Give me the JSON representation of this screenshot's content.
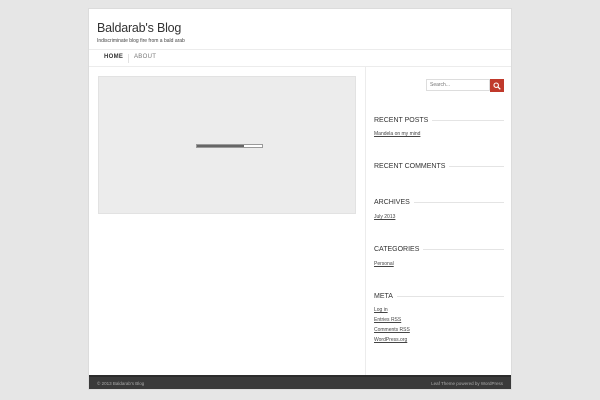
{
  "site": {
    "title": "Baldarab's Blog",
    "description": "Indiscriminate blog fire from a bald arab"
  },
  "nav": {
    "home": "Home",
    "about": "About"
  },
  "search": {
    "placeholder": "Search..."
  },
  "loader": {
    "progress": 0.72
  },
  "widgets": {
    "recent_posts": {
      "title": "Recent Posts",
      "items": [
        "Mandela on my mind"
      ]
    },
    "recent_comments": {
      "title": "Recent Comments"
    },
    "archives": {
      "title": "Archives",
      "items": [
        "July 2013"
      ]
    },
    "categories": {
      "title": "Categories",
      "items": [
        "Personal"
      ]
    },
    "meta": {
      "title": "Meta",
      "items": [
        "Log in",
        "Entries RSS",
        "Comments RSS",
        "WordPress.org"
      ]
    }
  },
  "footer": {
    "copyright": "© 2013 Baldarab's Blog",
    "credit": "Leaf Theme powered by WordPress"
  },
  "colors": {
    "accent": "#c0392b",
    "footer_bg": "#3a3a3a"
  }
}
